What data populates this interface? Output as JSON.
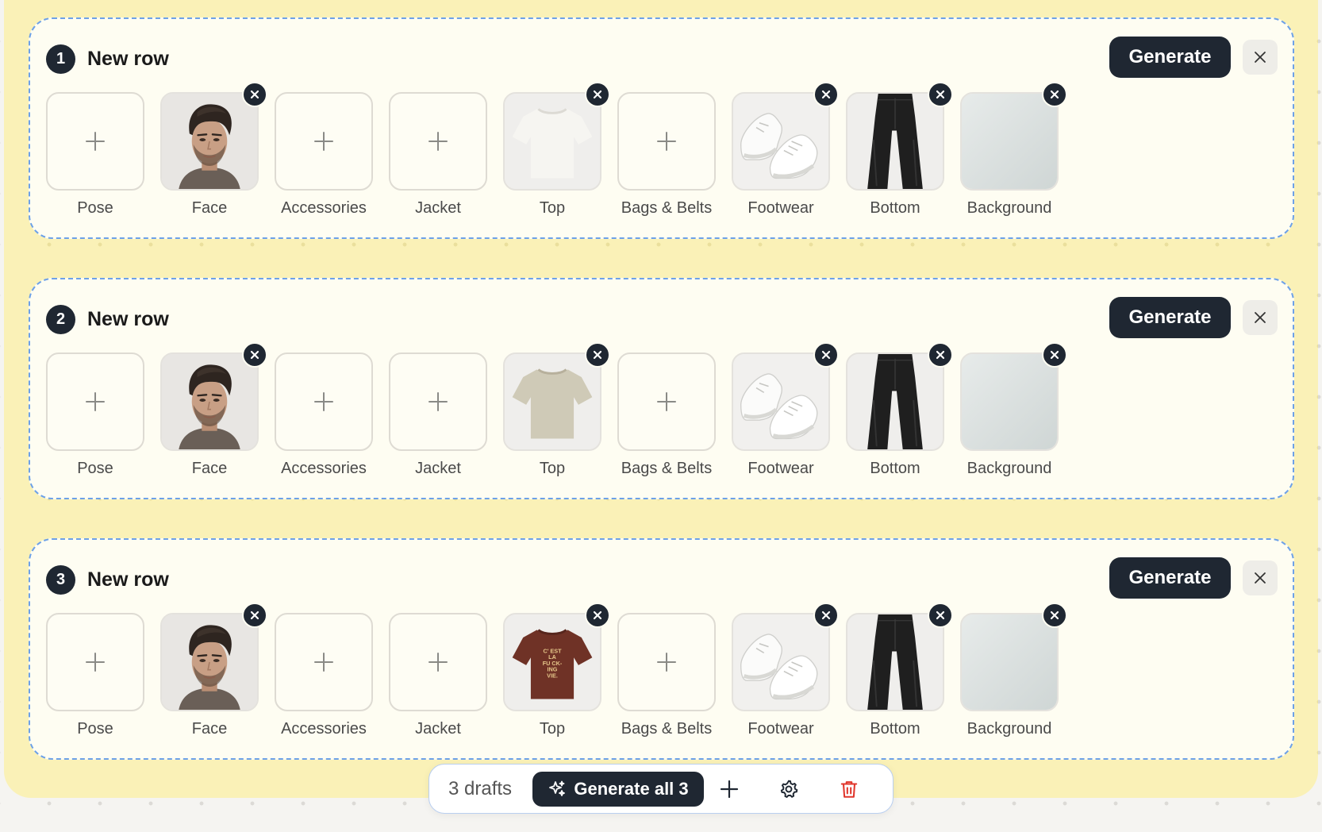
{
  "rows": [
    {
      "number": "1",
      "title": "New row",
      "generate_label": "Generate",
      "slots": [
        {
          "label": "Pose",
          "filled": false
        },
        {
          "label": "Face",
          "filled": true,
          "icon": "portrait-image"
        },
        {
          "label": "Accessories",
          "filled": false
        },
        {
          "label": "Jacket",
          "filled": false
        },
        {
          "label": "Top",
          "filled": true,
          "icon": "white-tshirt-image"
        },
        {
          "label": "Bags & Belts",
          "filled": false
        },
        {
          "label": "Footwear",
          "filled": true,
          "icon": "white-sneakers-image"
        },
        {
          "label": "Bottom",
          "filled": true,
          "icon": "black-jeans-image"
        },
        {
          "label": "Background",
          "filled": true,
          "icon": "light-gray-background-image"
        }
      ]
    },
    {
      "number": "2",
      "title": "New row",
      "generate_label": "Generate",
      "slots": [
        {
          "label": "Pose",
          "filled": false
        },
        {
          "label": "Face",
          "filled": true,
          "icon": "portrait-image"
        },
        {
          "label": "Accessories",
          "filled": false
        },
        {
          "label": "Jacket",
          "filled": false
        },
        {
          "label": "Top",
          "filled": true,
          "icon": "beige-tshirt-image"
        },
        {
          "label": "Bags & Belts",
          "filled": false
        },
        {
          "label": "Footwear",
          "filled": true,
          "icon": "white-sneakers-image"
        },
        {
          "label": "Bottom",
          "filled": true,
          "icon": "black-jeans-image"
        },
        {
          "label": "Background",
          "filled": true,
          "icon": "light-gray-background-image"
        }
      ]
    },
    {
      "number": "3",
      "title": "New row",
      "generate_label": "Generate",
      "slots": [
        {
          "label": "Pose",
          "filled": false
        },
        {
          "label": "Face",
          "filled": true,
          "icon": "portrait-image"
        },
        {
          "label": "Accessories",
          "filled": false
        },
        {
          "label": "Jacket",
          "filled": false
        },
        {
          "label": "Top",
          "filled": true,
          "icon": "brown-graphic-tshirt-image"
        },
        {
          "label": "Bags & Belts",
          "filled": false
        },
        {
          "label": "Footwear",
          "filled": true,
          "icon": "white-sneakers-image"
        },
        {
          "label": "Bottom",
          "filled": true,
          "icon": "black-jeans-image"
        },
        {
          "label": "Background",
          "filled": true,
          "icon": "light-gray-background-image"
        }
      ]
    }
  ],
  "tshirt_print": {
    "lines": [
      "C' EST",
      "LA",
      "FU CK-",
      "ING",
      "VIE."
    ]
  },
  "toolbar": {
    "drafts_label": "3 drafts",
    "generate_all_label": "Generate all 3",
    "icons": [
      "sparkles-icon",
      "plus-icon",
      "gear-icon",
      "trash-icon"
    ]
  },
  "colors": {
    "canvas": "#faf1b7",
    "card": "#fefdf2",
    "card_border": "#6da1e8",
    "primary_button": "#1f2732",
    "danger": "#e0362c"
  }
}
